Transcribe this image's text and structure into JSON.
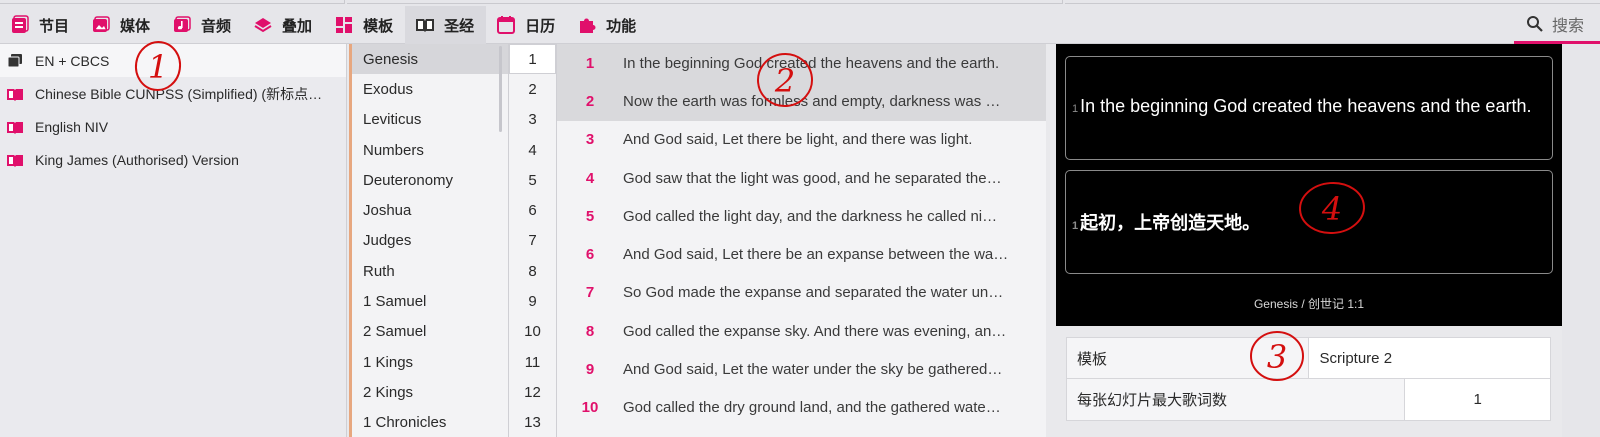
{
  "colors": {
    "accent": "#e0106b",
    "preview_bg": "#000000"
  },
  "nav": {
    "tabs": [
      {
        "label": "节目",
        "icon": "list-icon"
      },
      {
        "label": "媒体",
        "icon": "image-icon"
      },
      {
        "label": "音频",
        "icon": "music-icon"
      },
      {
        "label": "叠加",
        "icon": "layers-icon"
      },
      {
        "label": "模板",
        "icon": "grid-icon"
      },
      {
        "label": "圣经",
        "icon": "book-open-icon"
      },
      {
        "label": "日历",
        "icon": "calendar-icon"
      },
      {
        "label": "功能",
        "icon": "puzzle-icon"
      }
    ],
    "active_tab": "圣经",
    "search_label": "搜索"
  },
  "sources": [
    {
      "label": "EN + CBCS",
      "icon": "collection-icon"
    },
    {
      "label": "Chinese Bible CUNPSS (Simplified) (新标点…",
      "icon": "bible-icon"
    },
    {
      "label": "English NIV",
      "icon": "bible-icon"
    },
    {
      "label": "King James (Authorised) Version",
      "icon": "bible-icon"
    }
  ],
  "books": [
    "Genesis",
    "Exodus",
    "Leviticus",
    "Numbers",
    "Deuteronomy",
    "Joshua",
    "Judges",
    "Ruth",
    "1 Samuel",
    "2 Samuel",
    "1 Kings",
    "2 Kings",
    "1 Chronicles"
  ],
  "chapters": [
    "1",
    "2",
    "3",
    "4",
    "5",
    "6",
    "7",
    "8",
    "9",
    "10",
    "11",
    "12",
    "13"
  ],
  "verses": [
    {
      "num": "1",
      "text": "In the beginning God created the heavens and the earth."
    },
    {
      "num": "2",
      "text": "Now the earth was formless and empty, darkness was …"
    },
    {
      "num": "3",
      "text": "And God said, Let there be light, and there was light."
    },
    {
      "num": "4",
      "text": "God saw that the light was good, and he separated the…"
    },
    {
      "num": "5",
      "text": "God called the light day, and the darkness he called ni…"
    },
    {
      "num": "6",
      "text": "And God said, Let there be an expanse between the wa…"
    },
    {
      "num": "7",
      "text": "So God made the expanse and separated the water un…"
    },
    {
      "num": "8",
      "text": "God called the expanse sky. And there was evening, an…"
    },
    {
      "num": "9",
      "text": "And God said, Let the water under the sky be gathered…"
    },
    {
      "num": "10",
      "text": "God called the dry ground land, and the gathered wate…"
    }
  ],
  "preview": {
    "slide1": {
      "num": "1",
      "text": "In the beginning God created the heavens and the earth."
    },
    "slide2": {
      "num": "1",
      "text": "起初，上帝创造天地。"
    },
    "reference": "Genesis / 创世记 1:1"
  },
  "properties": {
    "template_label": "模板",
    "template_value": "Scripture 2",
    "max_lines_label": "每张幻灯片最大歌词数",
    "max_lines_value": "1"
  },
  "annotations": [
    "1",
    "2",
    "3",
    "4"
  ]
}
